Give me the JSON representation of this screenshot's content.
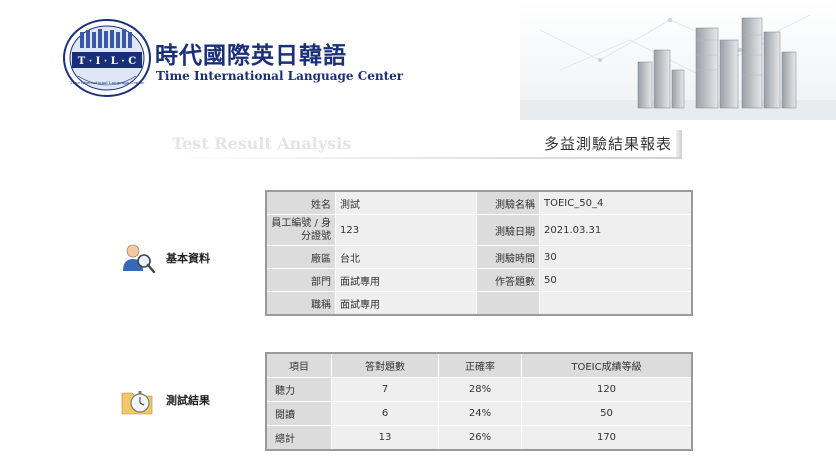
{
  "brand": {
    "seal_text": "T · I · L · C",
    "seal_ring_text": "Time International Language Center",
    "title": "時代國際英日韓語",
    "subtitle": "Time International Language Center"
  },
  "banner": {
    "ghost_text": "Test Result Analysis",
    "title": "多益測驗結果報表"
  },
  "sections": {
    "basic": "基本資料",
    "result": "測試結果"
  },
  "info": {
    "rows": [
      {
        "label": "姓名",
        "value": "測試",
        "label2": "測驗名稱",
        "value2": "TOEIC_50_4"
      },
      {
        "label": "員工編號 / 身分證號",
        "value": "123",
        "label2": "測驗日期",
        "value2": "2021.03.31"
      },
      {
        "label": "廠區",
        "value": "台北",
        "label2": "測驗時間",
        "value2": "30"
      },
      {
        "label": "部門",
        "value": "面試專用",
        "label2": "作答題數",
        "value2": "50"
      },
      {
        "label": "職稱",
        "value": "面試專用",
        "label2": "",
        "value2": ""
      }
    ]
  },
  "results": {
    "headers": [
      "項目",
      "答對題數",
      "正確率",
      "TOEIC成績等級"
    ],
    "rows": [
      [
        "聽力",
        "7",
        "28%",
        "120"
      ],
      [
        "閱讀",
        "6",
        "24%",
        "50"
      ],
      [
        "總計",
        "13",
        "26%",
        "170"
      ]
    ]
  }
}
